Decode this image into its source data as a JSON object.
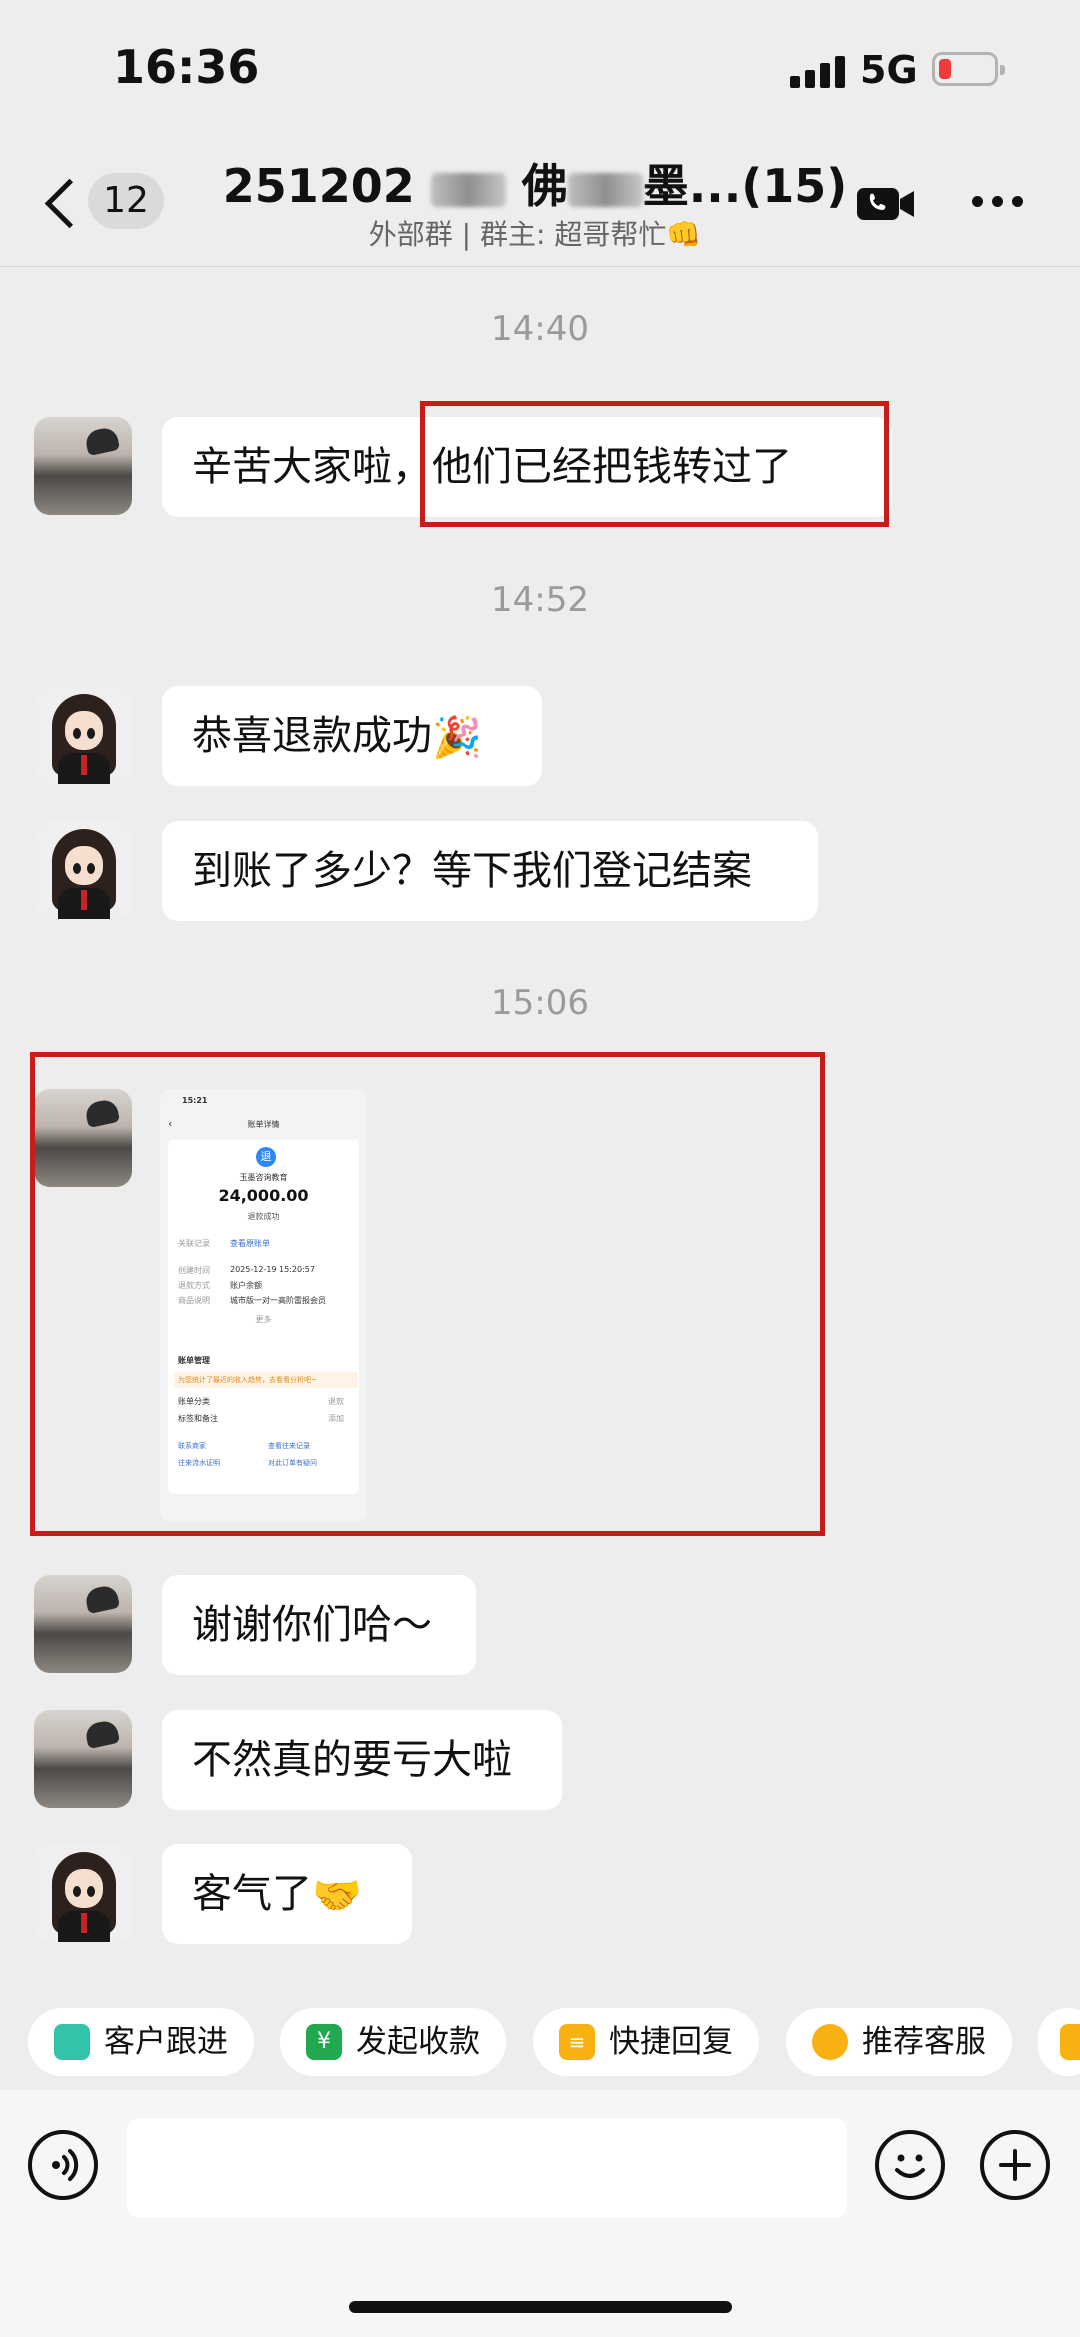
{
  "status_bar": {
    "time": "16:36",
    "network": "5G"
  },
  "nav": {
    "unread_count": "12",
    "title_start": "251202 ",
    "title_part1": "佛",
    "title_part2": "墨...(15)",
    "subtitle": "外部群 | 群主: 超哥帮忙👊"
  },
  "timestamps": [
    "14:40",
    "14:52",
    "15:06"
  ],
  "messages": {
    "m1_text": "辛苦大家啦，",
    "m1_highlight": "他们已经把钱转过了",
    "m2_text": "恭喜退款成功",
    "m2_emoji": "🎉",
    "m3_text": "到账了多少？等下我们登记结案",
    "m5_text": "谢谢你们哈～",
    "m6_text": "不然真的要亏大啦",
    "m7_text": "客气了",
    "m7_emoji": "🤝"
  },
  "screenshot": {
    "time": "15:21",
    "header": "账单详情",
    "logo_char": "退",
    "merchant": "玉墨咨询教育",
    "amount": "24,000.00",
    "status": "退款成功",
    "rows": [
      {
        "k": "关联记录",
        "v": "查看原账单"
      },
      {
        "k": "创建时间",
        "v": "2025-12-19 15:20:57"
      },
      {
        "k": "退款方式",
        "v": "账户余额"
      },
      {
        "k": "商品说明",
        "v": "城市版一对一高阶雷报会员"
      }
    ],
    "more": "更多",
    "section": "账单管理",
    "tip": "为您统计了最近的收入趋势，去看看分析吧~",
    "row_category": {
      "k": "账单分类",
      "v": "退款"
    },
    "row_tag": {
      "k": "标签和备注",
      "v": "添加"
    },
    "links": [
      "联系商家",
      "查看往来记录",
      "往来流水证明",
      "对此订单有疑问"
    ]
  },
  "quick_actions": [
    "客户跟进",
    "发起收款",
    "快捷回复",
    "推荐客服"
  ],
  "input": {
    "placeholder": ""
  },
  "colors": {
    "highlight": "#c61c1c",
    "background": "#ededed",
    "bubble": "#ffffff"
  }
}
